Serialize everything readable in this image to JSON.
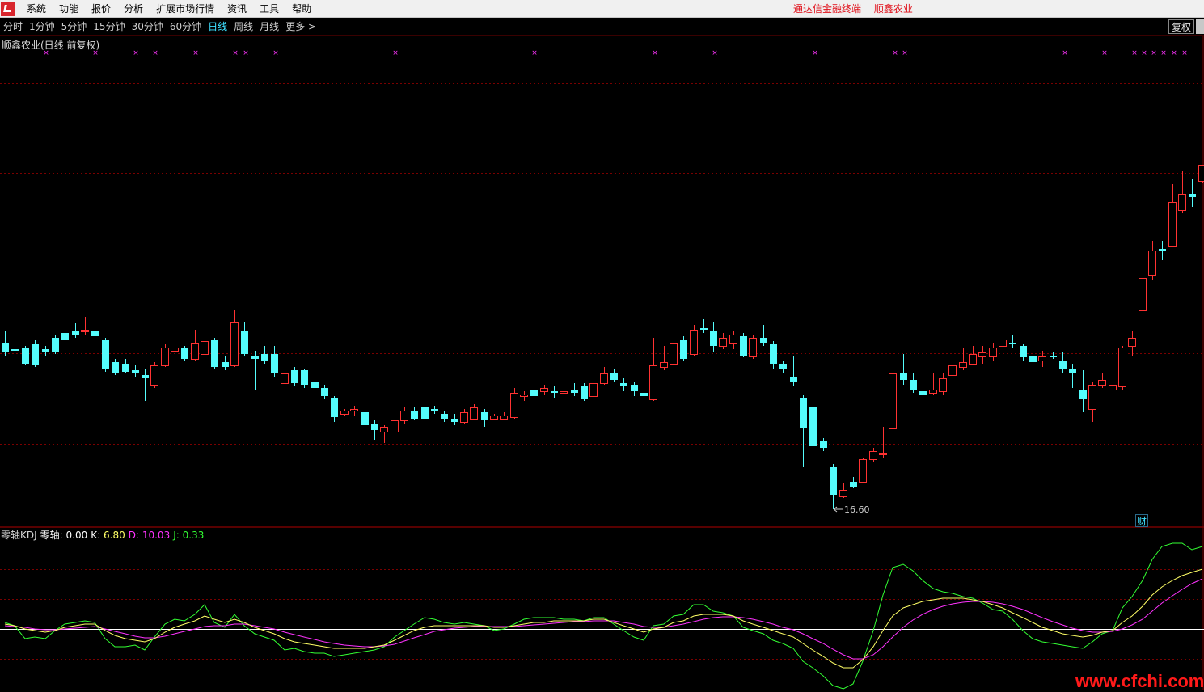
{
  "menubar": {
    "items": [
      "系统",
      "功能",
      "报价",
      "分析",
      "扩展市场行情",
      "资讯",
      "工具",
      "帮助"
    ],
    "right_links": [
      "通达信金融终端",
      "顺鑫农业"
    ]
  },
  "periodbar": {
    "items": [
      "分时",
      "1分钟",
      "5分钟",
      "15分钟",
      "30分钟",
      "60分钟",
      "日线",
      "周线",
      "月线",
      "更多 >"
    ],
    "active_index": 6,
    "restore_label": "复权"
  },
  "chart": {
    "title": "顺鑫农业(日线 前复权)",
    "low_marker": "16.60",
    "fin_badge": "财"
  },
  "indicator": {
    "name": "零轴KDJ",
    "zero_label": "零轴:",
    "zero_value": "0.00",
    "k_label": "K:",
    "k_value": "6.80",
    "d_label": "D:",
    "d_value": "10.03",
    "j_label": "J:",
    "j_value": "0.33"
  },
  "colors": {
    "up": "#ff3232",
    "down": "#54fcfc",
    "k_line": "#ffff66",
    "d_line": "#ff33ff",
    "j_line": "#33ff33",
    "zero_line": "#ffffff",
    "grid": "#7a0000",
    "marker": "#ff33ff"
  },
  "watermark": "www.cfchi.com"
}
